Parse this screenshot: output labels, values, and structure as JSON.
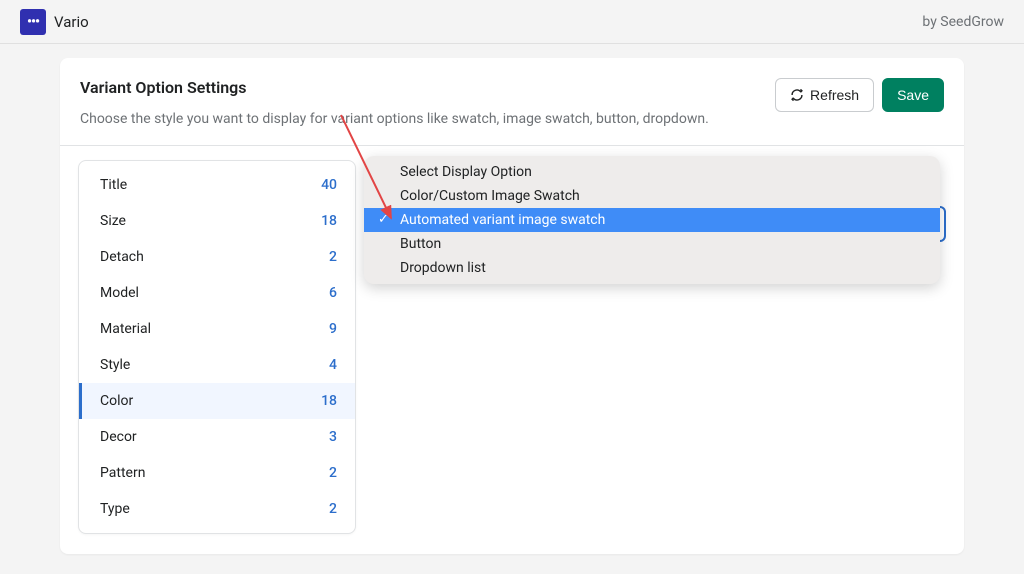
{
  "topbar": {
    "app_name": "Vario",
    "by_text": "by SeedGrow"
  },
  "header": {
    "title": "Variant Option Settings",
    "subtitle": "Choose the style you want to display for variant options like swatch, image swatch, button, dropdown.",
    "refresh_label": "Refresh",
    "save_label": "Save"
  },
  "sidebar": {
    "items": [
      {
        "label": "Title",
        "count": "40",
        "active": false
      },
      {
        "label": "Size",
        "count": "18",
        "active": false
      },
      {
        "label": "Detach",
        "count": "2",
        "active": false
      },
      {
        "label": "Model",
        "count": "6",
        "active": false
      },
      {
        "label": "Material",
        "count": "9",
        "active": false
      },
      {
        "label": "Style",
        "count": "4",
        "active": false
      },
      {
        "label": "Color",
        "count": "18",
        "active": true
      },
      {
        "label": "Decor",
        "count": "3",
        "active": false
      },
      {
        "label": "Pattern",
        "count": "2",
        "active": false
      },
      {
        "label": "Type",
        "count": "2",
        "active": false
      }
    ]
  },
  "dropdown": {
    "options": [
      {
        "label": "Select Display Option",
        "selected": false,
        "header": true
      },
      {
        "label": "Color/Custom Image Swatch",
        "selected": false,
        "header": false
      },
      {
        "label": "Automated variant image swatch",
        "selected": true,
        "header": false
      },
      {
        "label": "Button",
        "selected": false,
        "header": false
      },
      {
        "label": "Dropdown list",
        "selected": false,
        "header": false
      }
    ]
  }
}
